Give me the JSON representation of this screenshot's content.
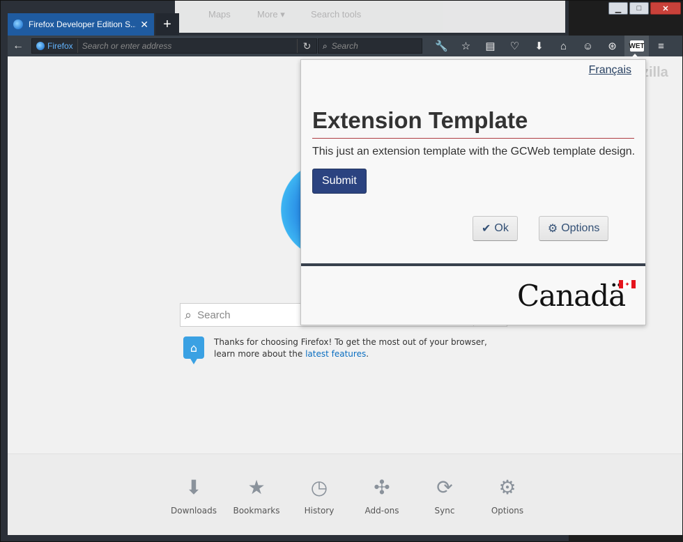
{
  "window": {
    "controls": {
      "minimize": "▁",
      "maximize": "□",
      "close": "✕"
    },
    "background_items": [
      "Maps",
      "More ▾",
      "Search tools"
    ]
  },
  "tab": {
    "title": "Firefox Developer Edition S...",
    "close": "✕",
    "new_tab": "+"
  },
  "toolbar": {
    "back": "←",
    "identity": "Firefox",
    "address_placeholder": "Search or enter address",
    "reload": "↻",
    "search_placeholder": "Search",
    "icons": [
      {
        "name": "wrench-icon",
        "glyph": "🔧"
      },
      {
        "name": "bookmark-star-icon",
        "glyph": "☆"
      },
      {
        "name": "reading-list-icon",
        "glyph": "▤"
      },
      {
        "name": "pocket-icon",
        "glyph": "♡"
      },
      {
        "name": "download-icon",
        "glyph": "⬇"
      },
      {
        "name": "home-icon",
        "glyph": "⌂"
      },
      {
        "name": "hello-icon",
        "glyph": "☺"
      },
      {
        "name": "developer-icon",
        "glyph": "⊛"
      },
      {
        "name": "wet-extension-icon",
        "glyph": "WET"
      },
      {
        "name": "menu-icon",
        "glyph": "≡"
      }
    ]
  },
  "content": {
    "mozilla_text": "zilla",
    "search_placeholder": "Search",
    "snippet_text": "Thanks for choosing Firefox! To get the most out of your browser, learn more about the",
    "snippet_link": "latest features",
    "snippet_end": ".",
    "launcher": [
      {
        "label": "Downloads",
        "icon": "download-icon",
        "glyph": "⬇"
      },
      {
        "label": "Bookmarks",
        "icon": "bookmark-icon",
        "glyph": "★"
      },
      {
        "label": "History",
        "icon": "history-icon",
        "glyph": "◷"
      },
      {
        "label": "Add-ons",
        "icon": "addons-icon",
        "glyph": "✣"
      },
      {
        "label": "Sync",
        "icon": "sync-icon",
        "glyph": "⟳"
      },
      {
        "label": "Options",
        "icon": "options-icon",
        "glyph": "⚙"
      }
    ]
  },
  "popup": {
    "language_link": "Français",
    "title": "Extension Template",
    "description": "This just an extension template with the GCWeb template design.",
    "submit_label": "Submit",
    "ok_label": "Ok",
    "options_label": "Options",
    "wordmark": "Canadä",
    "colors": {
      "title_rule": "#af3c43",
      "submit_bg": "#2b4380",
      "footer_rule": "#38414d",
      "flag_red": "#e5141c"
    }
  }
}
